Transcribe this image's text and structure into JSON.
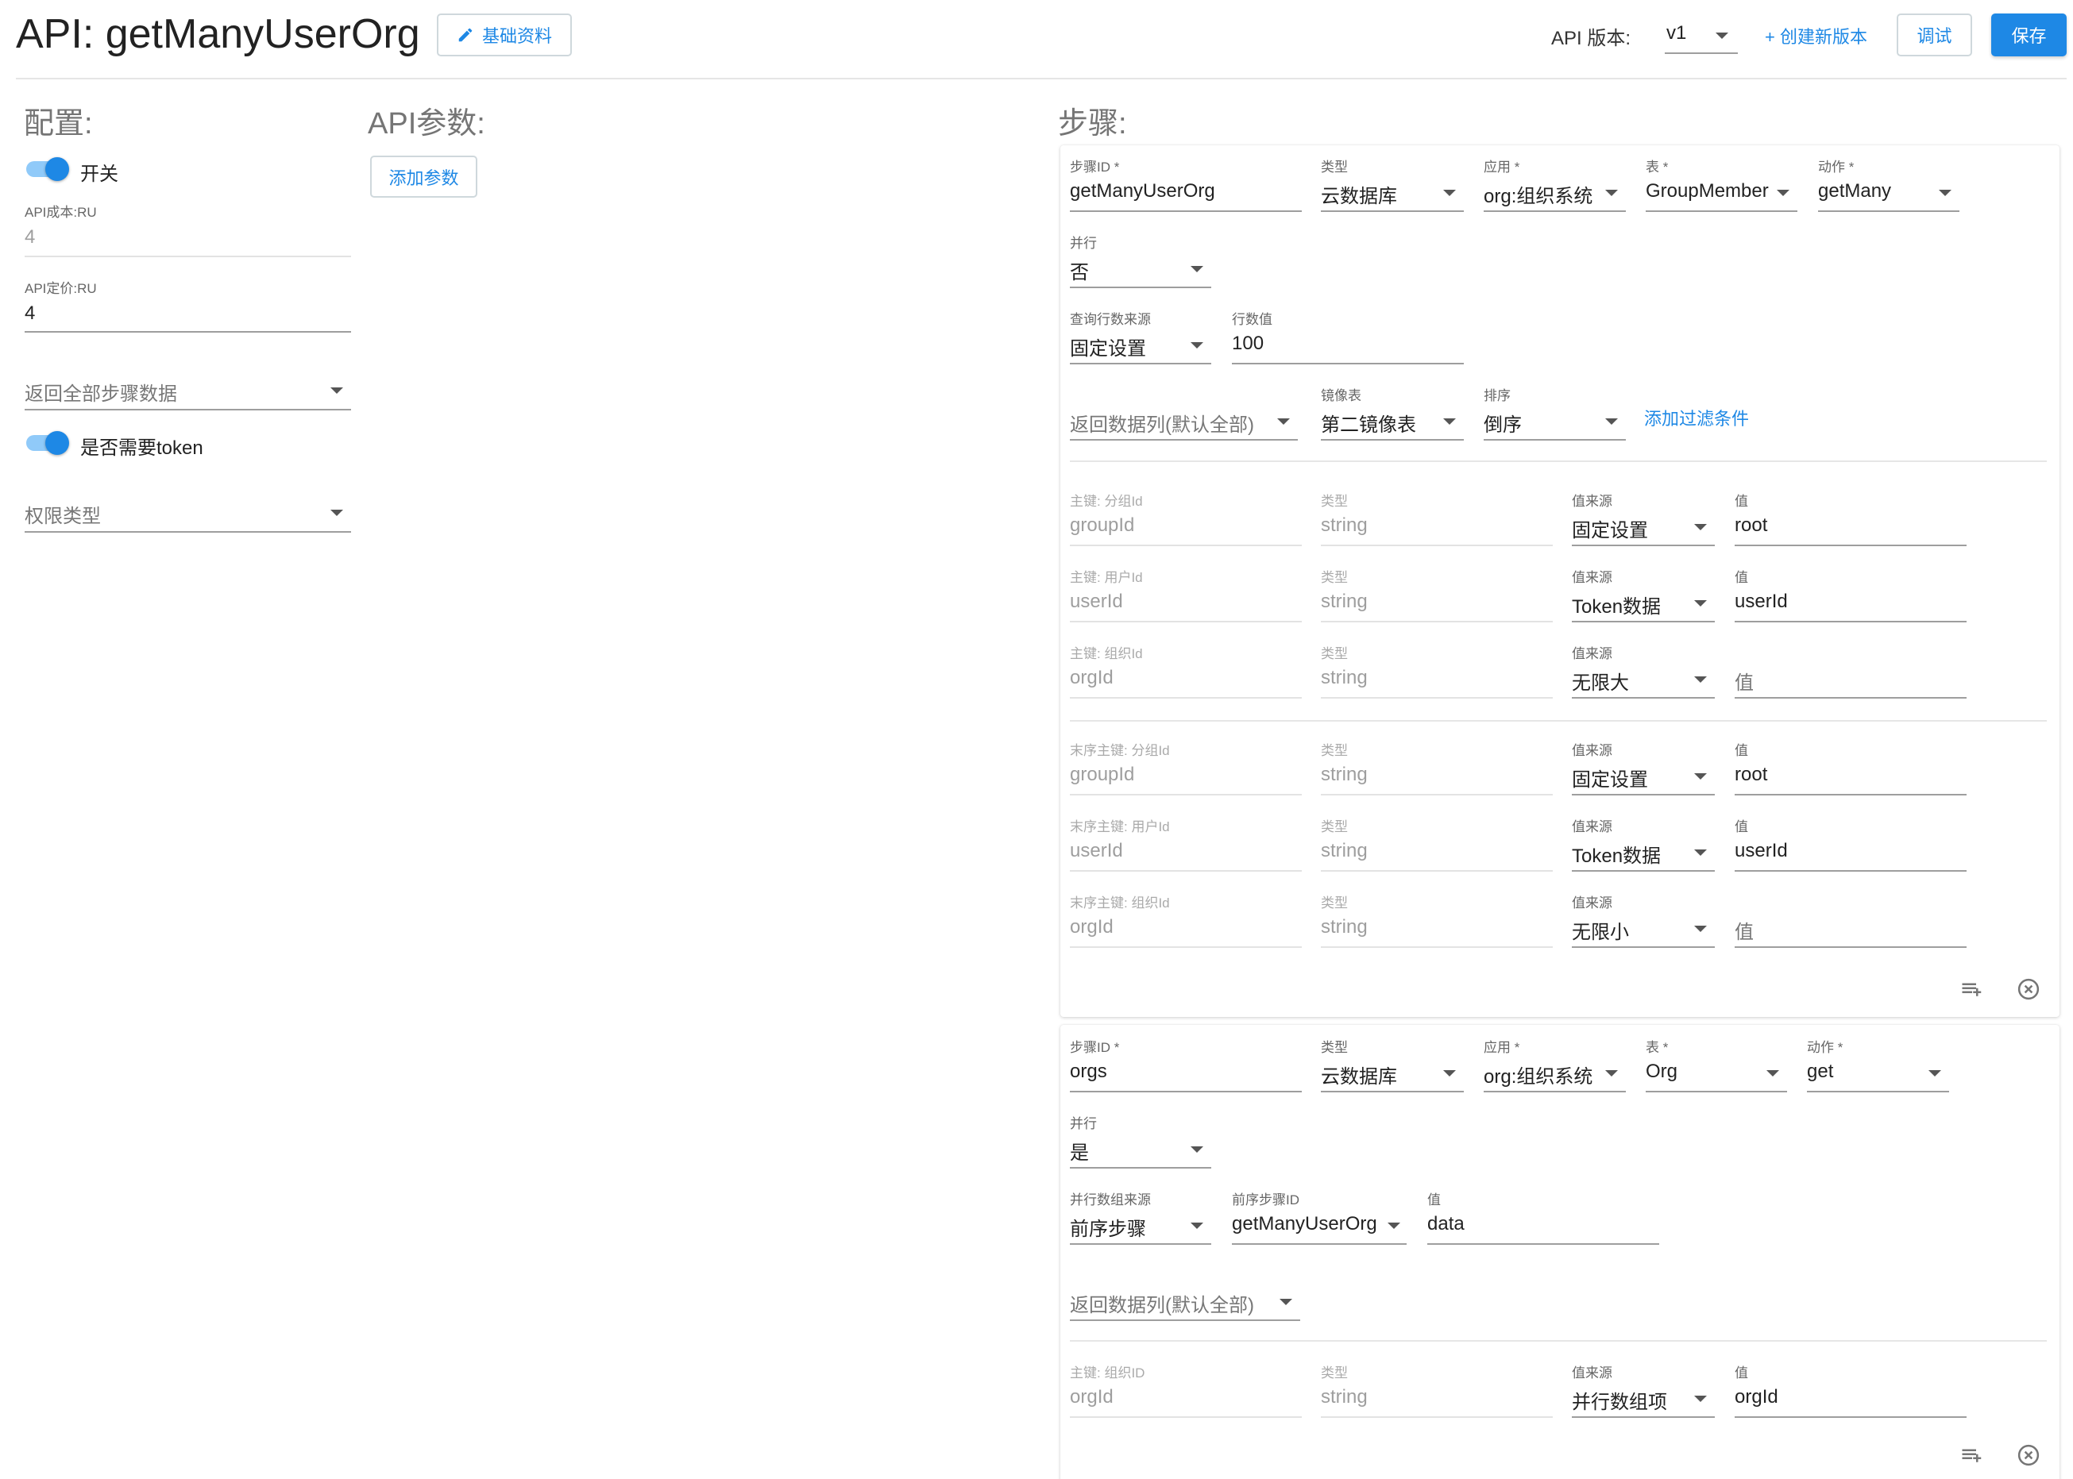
{
  "header": {
    "title": "API: getManyUserOrg",
    "basic_info_label": "基础资料",
    "api_version_label": "API 版本:",
    "version_value": "v1",
    "create_version_label": "+ 创建新版本",
    "debug_label": "调试",
    "save_label": "保存"
  },
  "config": {
    "title": "配置:",
    "switch_label": "开关",
    "cost_label": "API成本:RU",
    "cost_value": "4",
    "price_label": "API定价:RU",
    "price_value": "4",
    "return_all_placeholder": "返回全部步骤数据",
    "token_label": "是否需要token",
    "permission_placeholder": "权限类型"
  },
  "params": {
    "title": "API参数:",
    "add_label": "添加参数"
  },
  "steps": {
    "title": "步骤:",
    "step1": {
      "step_id_label": "步骤ID *",
      "step_id_value": "getManyUserOrg",
      "type_label": "类型",
      "type_value": "云数据库",
      "app_label": "应用 *",
      "app_value": "org:组织系统",
      "table_label": "表 *",
      "table_value": "GroupMember",
      "action_label": "动作 *",
      "action_value": "getMany",
      "parallel_label": "并行",
      "parallel_value": "否",
      "rows_source_label": "查询行数来源",
      "rows_source_value": "固定设置",
      "rows_value_label": "行数值",
      "rows_value": "100",
      "return_cols_placeholder": "返回数据列(默认全部)",
      "mirror_label": "镜像表",
      "mirror_value": "第二镜像表",
      "sort_label": "排序",
      "sort_value": "倒序",
      "add_filter_label": "添加过滤条件",
      "keys": [
        {
          "key_label": "主键: 分组Id",
          "key_value": "groupId",
          "type_label": "类型",
          "type_value": "string",
          "source_label": "值来源",
          "source_value": "固定设置",
          "val_label": "值",
          "val_value": "root"
        },
        {
          "key_label": "主键: 用户Id",
          "key_value": "userId",
          "type_label": "类型",
          "type_value": "string",
          "source_label": "值来源",
          "source_value": "Token数据",
          "val_label": "值",
          "val_value": "userId"
        },
        {
          "key_label": "主键: 组织Id",
          "key_value": "orgId",
          "type_label": "类型",
          "type_value": "string",
          "source_label": "值来源",
          "source_value": "无限大",
          "val_label": "",
          "val_value": "值"
        }
      ],
      "end_keys": [
        {
          "key_label": "末序主键: 分组Id",
          "key_value": "groupId",
          "type_label": "类型",
          "type_value": "string",
          "source_label": "值来源",
          "source_value": "固定设置",
          "val_label": "值",
          "val_value": "root"
        },
        {
          "key_label": "末序主键: 用户Id",
          "key_value": "userId",
          "type_label": "类型",
          "type_value": "string",
          "source_label": "值来源",
          "source_value": "Token数据",
          "val_label": "值",
          "val_value": "userId"
        },
        {
          "key_label": "末序主键: 组织Id",
          "key_value": "orgId",
          "type_label": "类型",
          "type_value": "string",
          "source_label": "值来源",
          "source_value": "无限小",
          "val_label": "",
          "val_value": "值"
        }
      ]
    },
    "step2": {
      "step_id_label": "步骤ID *",
      "step_id_value": "orgs",
      "type_label": "类型",
      "type_value": "云数据库",
      "app_label": "应用 *",
      "app_value": "org:组织系统",
      "table_label": "表 *",
      "table_value": "Org",
      "action_label": "动作 *",
      "action_value": "get",
      "parallel_label": "并行",
      "parallel_value": "是",
      "array_source_label": "并行数组来源",
      "array_source_value": "前序步骤",
      "prev_step_label": "前序步骤ID",
      "prev_step_value": "getManyUserOrg",
      "value_label": "值",
      "value_value": "data",
      "return_cols_placeholder": "返回数据列(默认全部)",
      "keys": [
        {
          "key_label": "主键: 组织ID",
          "key_value": "orgId",
          "type_label": "类型",
          "type_value": "string",
          "source_label": "值来源",
          "source_value": "并行数组项",
          "val_label": "值",
          "val_value": "orgId"
        }
      ]
    }
  },
  "colors": {
    "primary": "#1e88e5",
    "toggle_track": "#90caf9"
  }
}
